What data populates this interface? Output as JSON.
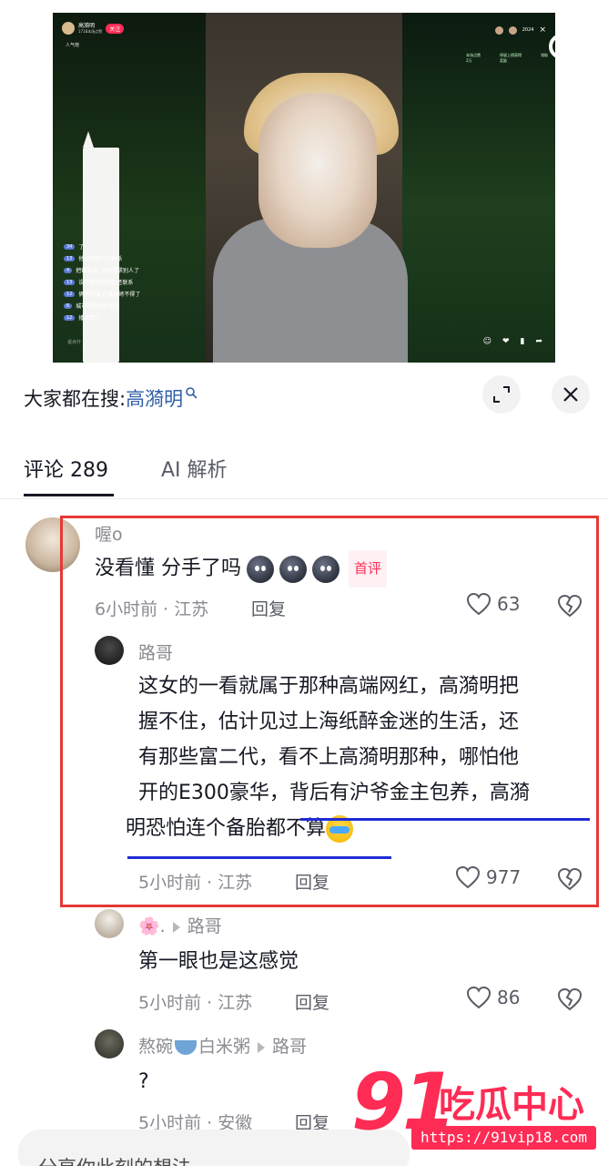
{
  "video": {
    "host_name": "高漪明",
    "host_fans": "1718本场点赞",
    "follow_label": "关注",
    "rank_label": "人气榜",
    "viewer_count": "2024",
    "close_glyph": "×",
    "info_left": "本场点赞",
    "info_left_value": "2万",
    "info_mid": "停留上榜获得",
    "info_mid_sub": "奖励",
    "info_right": "领取",
    "chat": [
      {
        "badge": "34",
        "text": "了?"
      },
      {
        "badge": "13",
        "text": "他说你跟前任联系"
      },
      {
        "badge": "4",
        "text": "把都乱搞, 你还要求别人了"
      },
      {
        "badge": "13",
        "text": "说你跟你前女友还联系"
      },
      {
        "badge": "12",
        "text": "俩都开播 连麦对峙不得了"
      },
      {
        "badge": "6",
        "text": "城市还是机会多吧"
      },
      {
        "badge": "12",
        "text": "播点赞了"
      }
    ],
    "chat_input": "说点什",
    "search_fab_icon": "search-icon"
  },
  "sheet": {
    "search_prefix": "大家都在搜:",
    "search_term": "高漪明",
    "tabs": {
      "comments": "评论 289",
      "ai": "AI 解析"
    },
    "comments": [
      {
        "name": "喔o",
        "text": "没看懂 分手了吗",
        "badge": "首评",
        "time": "6小时前 · 江苏",
        "reply": "回复",
        "likes": "63"
      }
    ],
    "replies": [
      {
        "name": "路哥",
        "lines": [
          "这女的一看就属于那种高端网红，高漪明把",
          "握不住，估计见过上海纸醉金迷的生活，还",
          "有那些富二代，看不上高漪明那种，哪怕他",
          "开的E300豪华，背后有沪爷金主包养，高漪",
          "明恐怕连个备胎都不算"
        ],
        "time": "5小时前 · 江苏",
        "reply": "回复",
        "likes": "977"
      },
      {
        "name_emoji": "🌸.",
        "target": "路哥",
        "text": "第一眼也是这感觉",
        "time": "5小时前 · 江苏",
        "reply": "回复",
        "likes": "86"
      },
      {
        "name_a": "熬碗",
        "name_b": "白米粥",
        "target": "路哥",
        "text": "?",
        "time": "5小时前 · 安徽",
        "reply": "回复"
      }
    ],
    "composer_placeholder": "分享你此刻的想法"
  },
  "watermark": {
    "big": "91",
    "cn": "吃瓜中心",
    "url": "https://91vip18.com"
  },
  "colors": {
    "accent": "#fe2c55",
    "link_blue": "#2f5ea8",
    "highlight_red": "#e53935",
    "underline_blue": "#1f2bd6"
  }
}
